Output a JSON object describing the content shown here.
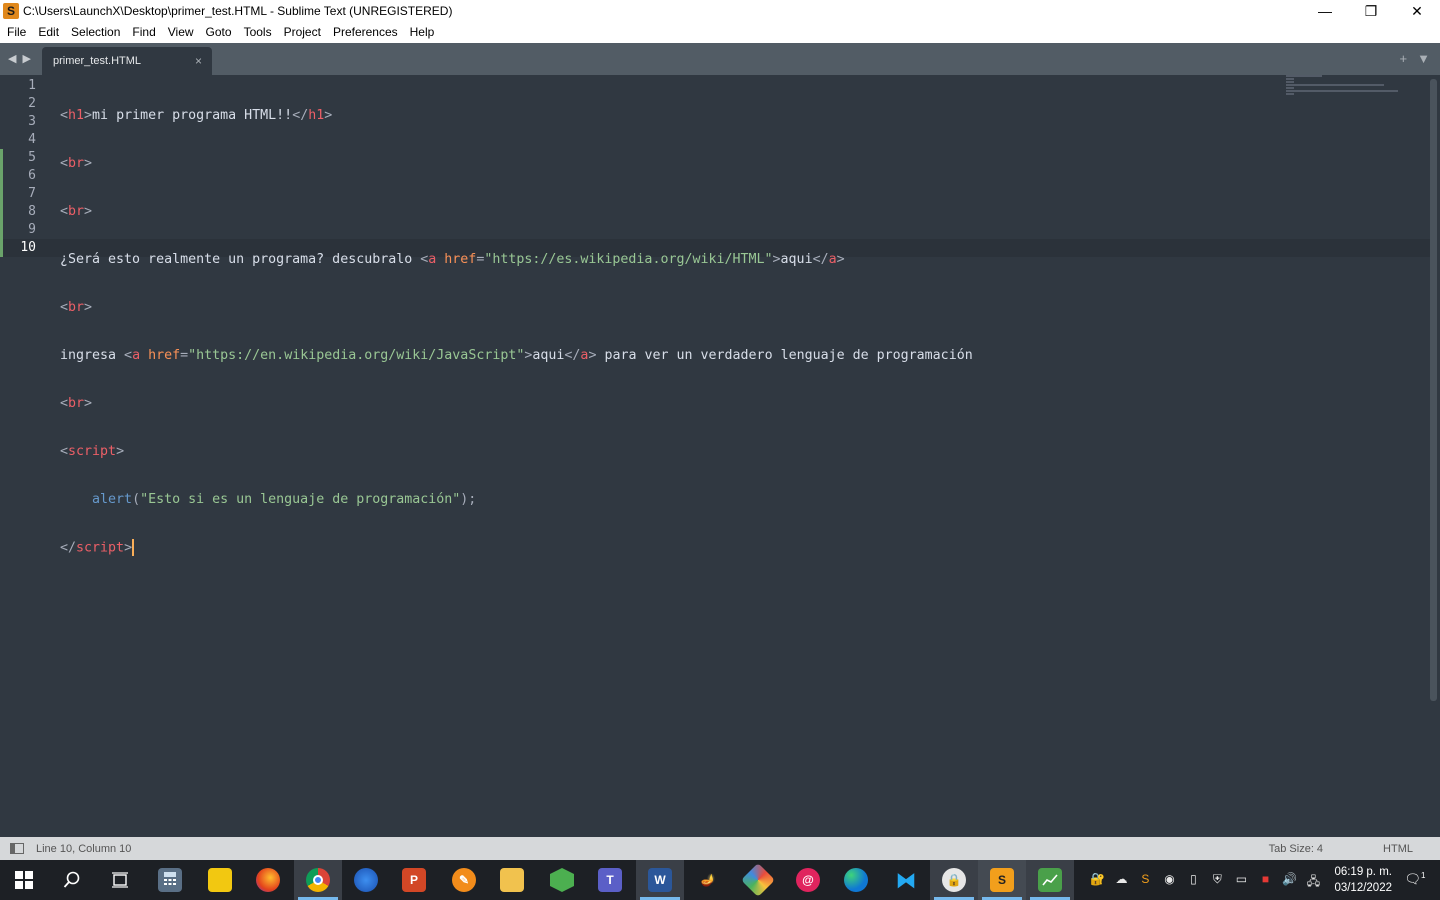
{
  "window": {
    "title": "C:\\Users\\LaunchX\\Desktop\\primer_test.HTML - Sublime Text (UNREGISTERED)",
    "app_icon_glyph": "S",
    "controls": {
      "minimize": "—",
      "restore": "❐",
      "close": "✕"
    }
  },
  "menu": [
    "File",
    "Edit",
    "Selection",
    "Find",
    "View",
    "Goto",
    "Tools",
    "Project",
    "Preferences",
    "Help"
  ],
  "tabbar": {
    "back_glyph": "◀",
    "forward_glyph": "▶",
    "tab": {
      "label": "primer_test.HTML",
      "close_glyph": "×"
    },
    "new_tab_glyph": "+",
    "tab_list_glyph": "▼"
  },
  "editor": {
    "line_numbers": [
      "1",
      "2",
      "3",
      "4",
      "5",
      "6",
      "7",
      "8",
      "9",
      "10"
    ],
    "current_line": 10,
    "lines": {
      "l1": {
        "p1": "<",
        "tag": "h1",
        "p2": ">",
        "text": "mi primer programa HTML!!",
        "p3": "</",
        "tag2": "h1",
        "p4": ">"
      },
      "l2": {
        "p1": "<",
        "tag": "br",
        "p2": ">"
      },
      "l3": {
        "p1": "<",
        "tag": "br",
        "p2": ">"
      },
      "l4": {
        "text": "¿Será esto realmente un programa? descubralo ",
        "p1": "<",
        "tag": "a",
        "attr": " href",
        "eq": "=",
        "str": "\"https://es.wikipedia.org/wiki/HTML\"",
        "p2": ">",
        "text2": "aqui",
        "p3": "</",
        "tag2": "a",
        "p4": ">"
      },
      "l5": {
        "p1": "<",
        "tag": "br",
        "p2": ">"
      },
      "l6": {
        "text": "ingresa ",
        "p1": "<",
        "tag": "a",
        "attr": " href",
        "eq": "=",
        "str": "\"https://en.wikipedia.org/wiki/JavaScript\"",
        "p2": ">",
        "text2": "aqui",
        "p3": "</",
        "tag2": "a",
        "p4": ">",
        "text3": " para ver un verdadero lenguaje de programación"
      },
      "l7": {
        "p1": "<",
        "tag": "br",
        "p2": ">"
      },
      "l8": {
        "p1": "<",
        "tag": "script",
        "p2": ">"
      },
      "l9": {
        "indent": "    ",
        "func": "alert",
        "p1": "(",
        "str": "\"Esto si es un lenguaje de programación\"",
        "p2": ");"
      },
      "l10": {
        "p1": "</",
        "tag": "script",
        "p2": ">"
      }
    }
  },
  "statusbar": {
    "position": "Line 10, Column 10",
    "tab_size": "Tab Size: 4",
    "syntax": "HTML"
  },
  "taskbar": {
    "clock_time": "06:19 p. m.",
    "clock_date": "03/12/2022",
    "notification_count": "1"
  }
}
